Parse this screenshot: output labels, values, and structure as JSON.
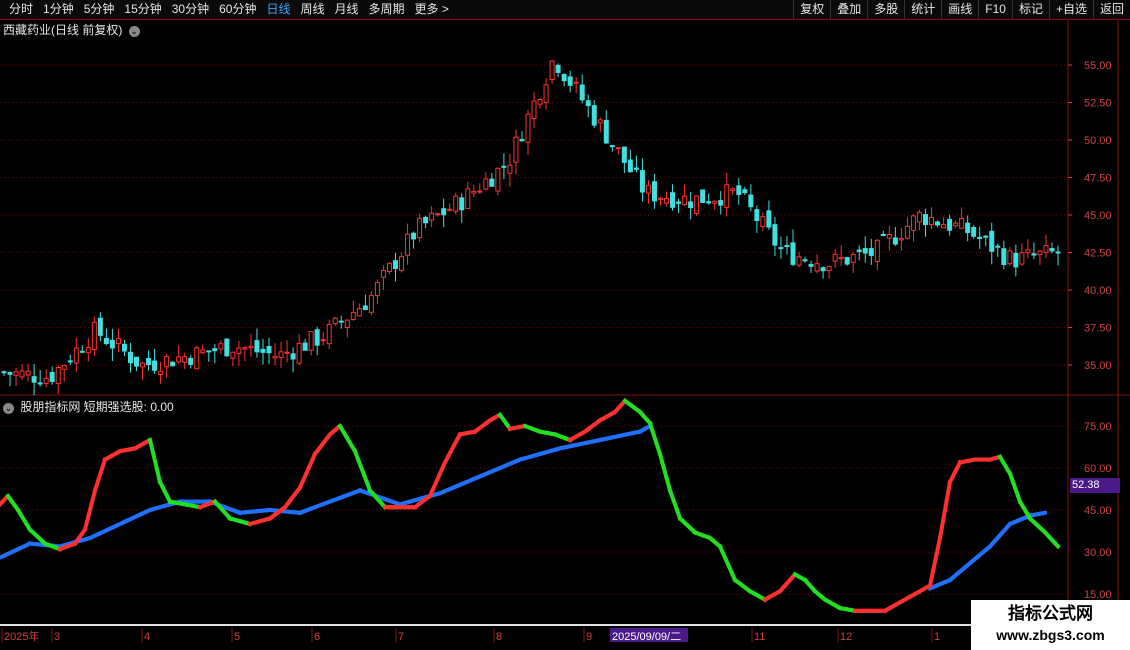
{
  "toolbar": {
    "periods": [
      "分时",
      "1分钟",
      "5分钟",
      "15分钟",
      "30分钟",
      "60分钟",
      "日线",
      "周线",
      "月线",
      "多周期",
      "更多 >"
    ],
    "active_period": "日线",
    "tools": [
      "复权",
      "叠加",
      "多股",
      "统计",
      "画线",
      "F10",
      "标记",
      "+自选",
      "返回"
    ]
  },
  "main_chart": {
    "title": "西藏药业(日线 前复权)",
    "price_ticks": [
      "55.00",
      "52.50",
      "50.00",
      "47.50",
      "45.00",
      "42.50",
      "40.00",
      "37.50",
      "35.00"
    ]
  },
  "indicator": {
    "title": "股朋指标网  短期强选股: 0.00",
    "ticks": [
      "75.00",
      "60.00",
      "45.00",
      "30.00",
      "15.00"
    ],
    "current_value": "52.38"
  },
  "date_axis": {
    "labels": [
      "2025年",
      "3",
      "4",
      "5",
      "6",
      "7",
      "8",
      "9",
      "2025/09/09/二",
      "11",
      "12",
      "1"
    ]
  },
  "watermark": {
    "title": "指标公式网",
    "url": "www.zbgs3.com"
  },
  "colors": {
    "up": "#ff3030",
    "down": "#40e0e0",
    "green_line": "#20e020",
    "blue_line": "#2070ff",
    "grid": "#5a0a0a",
    "axis_text": "#d04040"
  },
  "chart_data": [
    {
      "type": "candlestick",
      "title": "西藏药业(日线 前复权)",
      "ylim": [
        33,
        58
      ],
      "close_trend": [
        {
          "x": "2025-02",
          "y": 34.5
        },
        {
          "x": "2025-03",
          "y": 34.2
        },
        {
          "x": "2025-03-20",
          "y": 37.3
        },
        {
          "x": "2025-04-08",
          "y": 35.0
        },
        {
          "x": "2025-05",
          "y": 35.6
        },
        {
          "x": "2025-06",
          "y": 36.3
        },
        {
          "x": "2025-07",
          "y": 35.6
        },
        {
          "x": "2025-07-25",
          "y": 37.0
        },
        {
          "x": "2025-08-05",
          "y": 39.5
        },
        {
          "x": "2025-08-15",
          "y": 44.0
        },
        {
          "x": "2025-08-25",
          "y": 46.0
        },
        {
          "x": "2025-09-05",
          "y": 48.5
        },
        {
          "x": "2025-09-15",
          "y": 55.5
        },
        {
          "x": "2025-09-25",
          "y": 51.0
        },
        {
          "x": "2025-10-05",
          "y": 46.5
        },
        {
          "x": "2025-10-20",
          "y": 46.0
        },
        {
          "x": "2025-11-01",
          "y": 46.5
        },
        {
          "x": "2025-11-10",
          "y": 42.5
        },
        {
          "x": "2025-11-25",
          "y": 41.8
        },
        {
          "x": "2025-12-10",
          "y": 42.5
        },
        {
          "x": "2025-12-25",
          "y": 45.0
        },
        {
          "x": "2026-01-10",
          "y": 44.0
        },
        {
          "x": "2026-01-20",
          "y": 42.0
        },
        {
          "x": "2026-01-30",
          "y": 42.5
        }
      ]
    },
    {
      "type": "line",
      "title": "股朋指标网  短期强选股",
      "ylim": [
        5,
        85
      ],
      "series": [
        {
          "name": "short",
          "values": [
            [
              0,
              47
            ],
            [
              8,
              50
            ],
            [
              18,
              45
            ],
            [
              30,
              38
            ],
            [
              45,
              33
            ],
            [
              60,
              31
            ],
            [
              75,
              33
            ],
            [
              85,
              38
            ],
            [
              95,
              52
            ],
            [
              105,
              63
            ],
            [
              120,
              66
            ],
            [
              135,
              67
            ],
            [
              150,
              70
            ],
            [
              160,
              55
            ],
            [
              170,
              48
            ],
            [
              185,
              47
            ],
            [
              200,
              46
            ],
            [
              215,
              48
            ],
            [
              230,
              42
            ],
            [
              250,
              40
            ],
            [
              270,
              42
            ],
            [
              285,
              46
            ],
            [
              300,
              53
            ],
            [
              315,
              65
            ],
            [
              330,
              72
            ],
            [
              340,
              75
            ],
            [
              355,
              66
            ],
            [
              370,
              52
            ],
            [
              385,
              46
            ],
            [
              400,
              46
            ],
            [
              415,
              46
            ],
            [
              430,
              50
            ],
            [
              445,
              62
            ],
            [
              460,
              72
            ],
            [
              475,
              73
            ],
            [
              490,
              77
            ],
            [
              500,
              79
            ],
            [
              510,
              74
            ],
            [
              525,
              75
            ],
            [
              540,
              73
            ],
            [
              555,
              72
            ],
            [
              570,
              70
            ],
            [
              585,
              73
            ],
            [
              600,
              77
            ],
            [
              615,
              80
            ],
            [
              625,
              84
            ],
            [
              640,
              80
            ],
            [
              650,
              76
            ],
            [
              660,
              65
            ],
            [
              670,
              52
            ],
            [
              680,
              42
            ],
            [
              695,
              37
            ],
            [
              710,
              35
            ],
            [
              720,
              32
            ],
            [
              735,
              20
            ],
            [
              750,
              16
            ],
            [
              765,
              13
            ],
            [
              780,
              16
            ],
            [
              795,
              22
            ],
            [
              805,
              20
            ],
            [
              815,
              16
            ],
            [
              825,
              13
            ],
            [
              840,
              10
            ],
            [
              855,
              9
            ],
            [
              870,
              9
            ],
            [
              885,
              9
            ],
            [
              900,
              12
            ],
            [
              915,
              15
            ],
            [
              930,
              18
            ],
            [
              940,
              35
            ],
            [
              950,
              55
            ],
            [
              960,
              62
            ],
            [
              975,
              63
            ],
            [
              990,
              63
            ],
            [
              1000,
              64
            ],
            [
              1010,
              58
            ],
            [
              1020,
              48
            ],
            [
              1030,
              42
            ],
            [
              1045,
              37
            ],
            [
              1058,
              32
            ]
          ]
        },
        {
          "name": "base",
          "values": [
            [
              0,
              28
            ],
            [
              30,
              33
            ],
            [
              60,
              32
            ],
            [
              90,
              35
            ],
            [
              120,
              40
            ],
            [
              150,
              45
            ],
            [
              180,
              48
            ],
            [
              210,
              48
            ],
            [
              240,
              44
            ],
            [
              270,
              45
            ],
            [
              300,
              44
            ],
            [
              330,
              48
            ],
            [
              360,
              52
            ],
            [
              400,
              47
            ],
            [
              440,
              51
            ],
            [
              480,
              57
            ],
            [
              520,
              63
            ],
            [
              560,
              67
            ],
            [
              600,
              70
            ],
            [
              640,
              73
            ],
            [
              650,
              75
            ]
          ]
        },
        {
          "name": "base2",
          "values": [
            [
              930,
              17
            ],
            [
              950,
              20
            ],
            [
              970,
              26
            ],
            [
              990,
              32
            ],
            [
              1010,
              40
            ],
            [
              1030,
              43
            ],
            [
              1045,
              44
            ]
          ]
        }
      ]
    }
  ]
}
